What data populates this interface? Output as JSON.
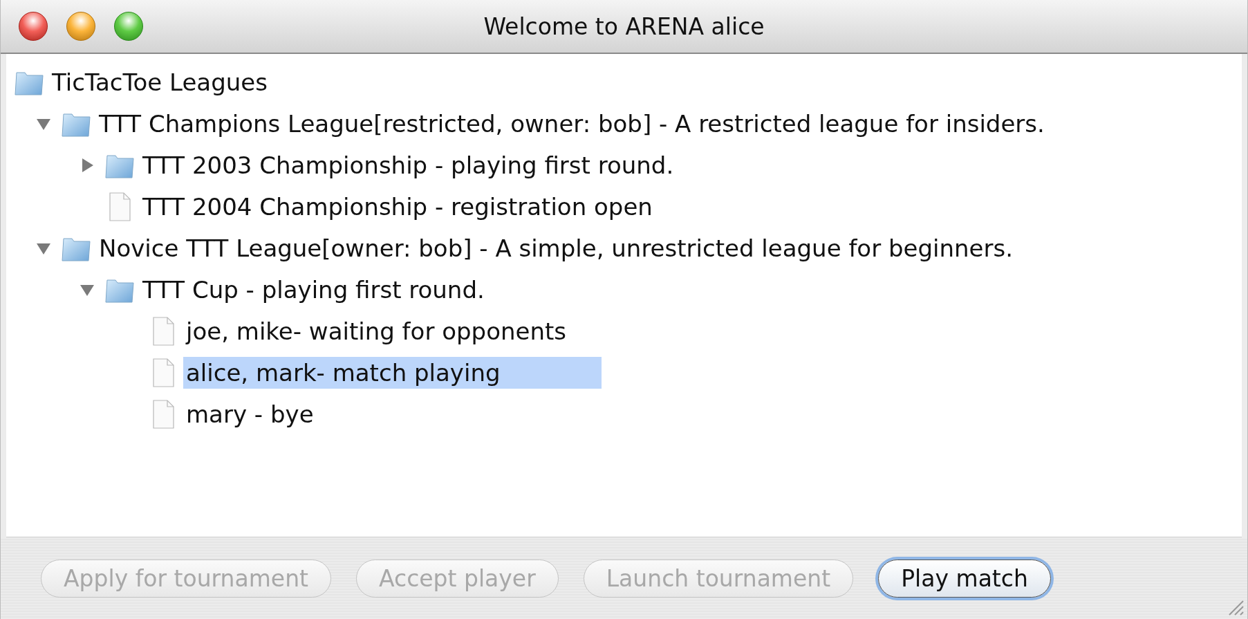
{
  "window": {
    "title": "Welcome to ARENA alice"
  },
  "tree": {
    "label": "TicTacToe Leagues",
    "kind": "folder",
    "selected": false,
    "children": [
      {
        "label": "TTT Champions League[restricted, owner: bob] - A restricted league for insiders.",
        "kind": "folder",
        "expanded": true,
        "selected": false,
        "children": [
          {
            "label": "TTT 2003 Championship - playing first round.",
            "kind": "folder",
            "expanded": false,
            "selected": false
          },
          {
            "label": "TTT 2004 Championship - registration open",
            "kind": "file",
            "selected": false
          }
        ]
      },
      {
        "label": "Novice TTT League[owner: bob] - A simple, unrestricted league for beginners.",
        "kind": "folder",
        "expanded": true,
        "selected": false,
        "children": [
          {
            "label": "TTT Cup - playing first round.",
            "kind": "folder",
            "expanded": true,
            "selected": false,
            "children": [
              {
                "label": "joe, mike- waiting for opponents",
                "kind": "file",
                "selected": false
              },
              {
                "label": "alice, mark- match playing",
                "kind": "file",
                "selected": true
              },
              {
                "label": "mary - bye",
                "kind": "file",
                "selected": false
              }
            ]
          }
        ]
      }
    ]
  },
  "buttons": [
    {
      "label": "Apply for tournament",
      "disabled": true,
      "default": false
    },
    {
      "label": "Accept player",
      "disabled": true,
      "default": false
    },
    {
      "label": "Launch tournament",
      "disabled": true,
      "default": false
    },
    {
      "label": "Play match",
      "disabled": false,
      "default": true
    }
  ]
}
